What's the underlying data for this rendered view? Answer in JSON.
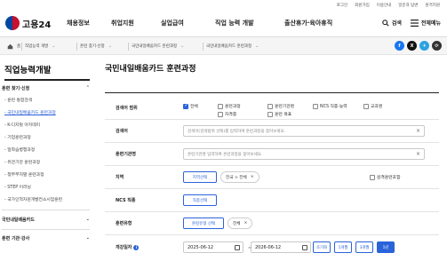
{
  "utility": [
    "로그인",
    "회원가입",
    "이용안내",
    "일문과 답변",
    "원격지원"
  ],
  "logo": {
    "text": "고용24"
  },
  "gnb": [
    "채용정보",
    "취업지원",
    "실업급여",
    "직업 능력 개발",
    "출산휴가·육아휴직"
  ],
  "header": {
    "search_label": "검색",
    "menu_label": "전체메뉴"
  },
  "breadcrumb": [
    "홈",
    "직업능력 개발",
    "훈련 찾기·신청",
    "국민내일배움카드 훈련과정",
    "국민내일배움카드 훈련과정"
  ],
  "social": [
    "f",
    "X",
    "✈",
    "⟳"
  ],
  "lnb": {
    "title": "직업능력개발",
    "section1": "훈련 찾기·신청",
    "items": [
      "- 훈련 통합검색",
      "- 국민내일배움카드 훈련과정",
      "- K-디지털 아카데미",
      "- 기업훈련과정",
      "- 일학습병행과정",
      "- 유관기관 훈련과정",
      "- 청부부처별 훈련과정",
      "- STEP 이러닝",
      "- 국가인적자원개발컨소시엄훈련"
    ],
    "section2": "국민내일배움카드",
    "section3": "훈련 기관·강사"
  },
  "main": {
    "title": "국민내일배움카드 훈련과정",
    "fields": {
      "scope": {
        "label": "검색어 범위",
        "options": [
          "전체",
          "훈련과정",
          "훈련기관명",
          "NCS 직종·능력",
          "교과명",
          "자격증",
          "훈련 목표"
        ]
      },
      "keyword": {
        "label": "검색어",
        "placeholder": "검색어(검색범위 선택)를 입력하여 훈련과정을 찾아보세요."
      },
      "institute": {
        "label": "훈련기관명",
        "placeholder": "훈련기관명 입력하여 훈련과정을 찾아보세요."
      },
      "region": {
        "label": "지역",
        "button": "지역선택",
        "chip": "전국 > 전체",
        "remote": "원격훈련포함"
      },
      "ncs": {
        "label": "NCS 직종",
        "button": "직종선택"
      },
      "type": {
        "label": "훈련유형",
        "button": "훈련유형 선택",
        "chip": "전체"
      },
      "start": {
        "label": "개강일자",
        "from": "2025-06-12",
        "tilde": "~",
        "to": "2026-06-12",
        "periods": [
          "조기화",
          "1개월",
          "3개월",
          "1년"
        ]
      }
    }
  },
  "colors": {
    "accent": "#2a63d9",
    "logo_red": "#c8102e",
    "logo_blue": "#0047a0"
  }
}
